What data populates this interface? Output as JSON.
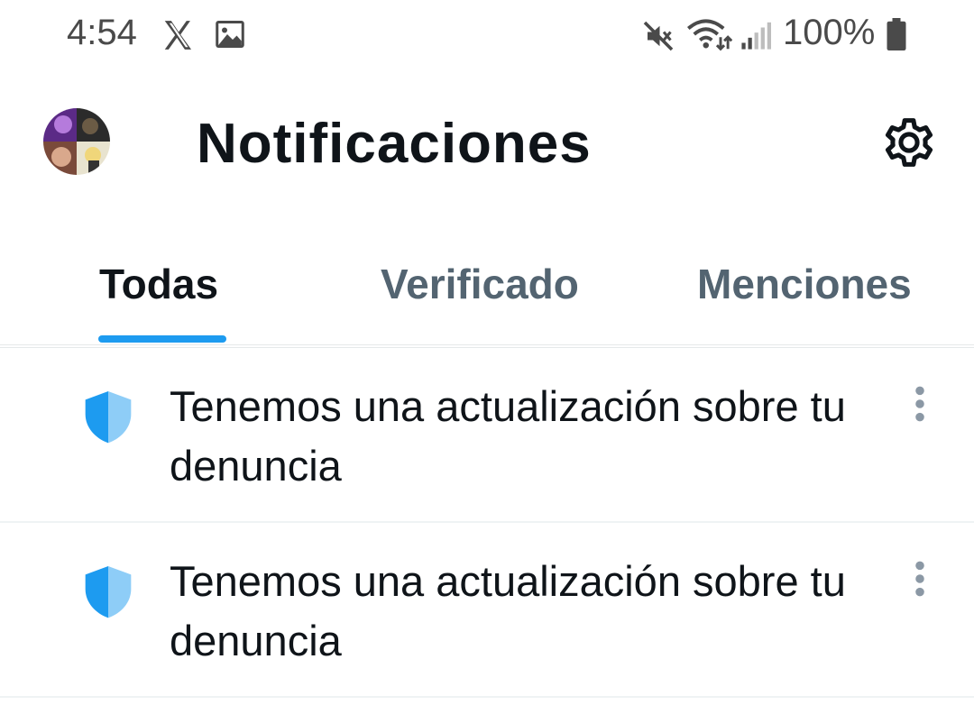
{
  "status_bar": {
    "time": "4:54",
    "battery": "100%",
    "icons": [
      "x-logo-icon",
      "image-icon",
      "mute-icon",
      "wifi-icon",
      "signal-icon",
      "battery-icon"
    ]
  },
  "header": {
    "title": "Notificaciones",
    "avatar": "avatar",
    "settings_icon": "gear-icon"
  },
  "tabs": [
    {
      "label": "Todas",
      "active": true
    },
    {
      "label": "Verificado",
      "active": false
    },
    {
      "label": "Menciones",
      "active": false
    }
  ],
  "notifications": [
    {
      "icon": "shield-icon",
      "text": "Tenemos una actualización sobre tu denuncia"
    },
    {
      "icon": "shield-icon",
      "text": "Tenemos una actualización sobre tu denuncia"
    }
  ],
  "colors": {
    "accent": "#1d9bf0",
    "text_primary": "#0f1419",
    "text_secondary": "#536471",
    "shield_dark": "#1d9bf0",
    "shield_light": "#8ecdf7"
  }
}
